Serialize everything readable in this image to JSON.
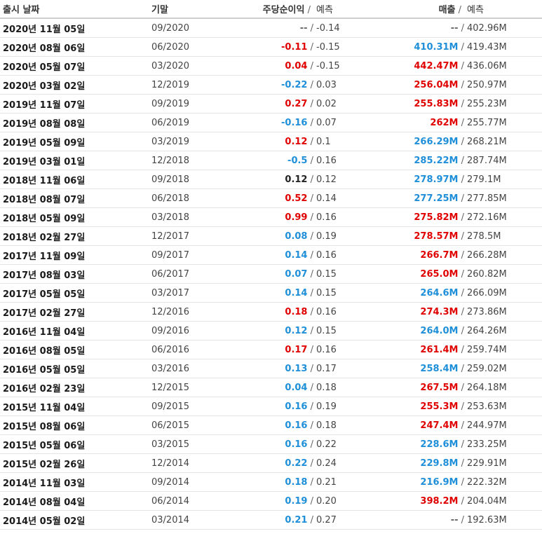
{
  "header": {
    "date": "출시 날짜",
    "period": "기말",
    "eps": "주당순이익",
    "sep": " / ",
    "forecast": "예측",
    "revenue": "매출",
    "sep2": " / ",
    "forecast2": "예측"
  },
  "colors": {
    "beat": "#1e8fd8",
    "miss": "#e00000",
    "neutral": "#222222"
  },
  "rows": [
    {
      "date": "2020년 11월 05일",
      "period": "09/2020",
      "eps": "--",
      "eps_status": "dim",
      "eps_sep": " /",
      "eps_forecast": "-0.14",
      "revenue": "--",
      "rev_status": "dim",
      "rev_sep": " /",
      "rev_forecast": "402.96M"
    },
    {
      "date": "2020년 08월 06일",
      "period": "06/2020",
      "eps": "-0.11",
      "eps_status": "neg",
      "eps_sep": " /",
      "eps_forecast": "-0.15",
      "revenue": "410.31M",
      "rev_status": "pos",
      "rev_sep": " /",
      "rev_forecast": "419.43M"
    },
    {
      "date": "2020년 05월 07일",
      "period": "03/2020",
      "eps": "0.04",
      "eps_status": "neg",
      "eps_sep": " /",
      "eps_forecast": "-0.15",
      "revenue": "442.47M",
      "rev_status": "neg",
      "rev_sep": " /",
      "rev_forecast": "436.06M"
    },
    {
      "date": "2020년 03월 02일",
      "period": "12/2019",
      "eps": "-0.22",
      "eps_status": "pos",
      "eps_sep": " /",
      "eps_forecast": "0.03",
      "revenue": "256.04M",
      "rev_status": "neg",
      "rev_sep": " /",
      "rev_forecast": "250.97M"
    },
    {
      "date": "2019년 11월 07일",
      "period": "09/2019",
      "eps": "0.27",
      "eps_status": "neg",
      "eps_sep": " /",
      "eps_forecast": "0.02",
      "revenue": "255.83M",
      "rev_status": "neg",
      "rev_sep": " /",
      "rev_forecast": "255.23M"
    },
    {
      "date": "2019년 08월 08일",
      "period": "06/2019",
      "eps": "-0.16",
      "eps_status": "pos",
      "eps_sep": " /",
      "eps_forecast": "0.07",
      "revenue": "262M",
      "rev_status": "neg",
      "rev_sep": " /",
      "rev_forecast": "255.77M"
    },
    {
      "date": "2019년 05월 09일",
      "period": "03/2019",
      "eps": "0.12",
      "eps_status": "neg",
      "eps_sep": " /",
      "eps_forecast": "0.1",
      "revenue": "266.29M",
      "rev_status": "pos",
      "rev_sep": " /",
      "rev_forecast": "268.21M"
    },
    {
      "date": "2019년 03월 01일",
      "period": "12/2018",
      "eps": "-0.5",
      "eps_status": "pos",
      "eps_sep": " /",
      "eps_forecast": "0.16",
      "revenue": "285.22M",
      "rev_status": "pos",
      "rev_sep": " /",
      "rev_forecast": "287.74M"
    },
    {
      "date": "2018년 11월 06일",
      "period": "09/2018",
      "eps": "0.12",
      "eps_status": "neu",
      "eps_sep": " /",
      "eps_forecast": "0.12",
      "revenue": "278.97M",
      "rev_status": "pos",
      "rev_sep": " /",
      "rev_forecast": "279.1M"
    },
    {
      "date": "2018년 08월 07일",
      "period": "06/2018",
      "eps": "0.52",
      "eps_status": "neg",
      "eps_sep": " /",
      "eps_forecast": "0.14",
      "revenue": "277.25M",
      "rev_status": "pos",
      "rev_sep": " /",
      "rev_forecast": "277.85M"
    },
    {
      "date": "2018년 05월 09일",
      "period": "03/2018",
      "eps": "0.99",
      "eps_status": "neg",
      "eps_sep": " /",
      "eps_forecast": "0.16",
      "revenue": "275.82M",
      "rev_status": "neg",
      "rev_sep": " /",
      "rev_forecast": "272.16M"
    },
    {
      "date": "2018년 02월 27일",
      "period": "12/2017",
      "eps": "0.08",
      "eps_status": "pos",
      "eps_sep": " /",
      "eps_forecast": "0.19",
      "revenue": "278.57M",
      "rev_status": "neg",
      "rev_sep": " /",
      "rev_forecast": "278.5M"
    },
    {
      "date": "2017년 11월 09일",
      "period": "09/2017",
      "eps": "0.14",
      "eps_status": "pos",
      "eps_sep": " /",
      "eps_forecast": "0.16",
      "revenue": "266.7M",
      "rev_status": "neg",
      "rev_sep": " /",
      "rev_forecast": "266.28M"
    },
    {
      "date": "2017년 08월 03일",
      "period": "06/2017",
      "eps": "0.07",
      "eps_status": "pos",
      "eps_sep": " /",
      "eps_forecast": "0.15",
      "revenue": "265.0M",
      "rev_status": "neg",
      "rev_sep": " /",
      "rev_forecast": "260.82M"
    },
    {
      "date": "2017년 05월 05일",
      "period": "03/2017",
      "eps": "0.14",
      "eps_status": "pos",
      "eps_sep": " /",
      "eps_forecast": "0.15",
      "revenue": "264.6M",
      "rev_status": "pos",
      "rev_sep": " /",
      "rev_forecast": "266.09M"
    },
    {
      "date": "2017년 02월 27일",
      "period": "12/2016",
      "eps": "0.18",
      "eps_status": "neg",
      "eps_sep": " /",
      "eps_forecast": "0.16",
      "revenue": "274.3M",
      "rev_status": "neg",
      "rev_sep": " /",
      "rev_forecast": "273.86M"
    },
    {
      "date": "2016년 11월 04일",
      "period": "09/2016",
      "eps": "0.12",
      "eps_status": "pos",
      "eps_sep": " /",
      "eps_forecast": "0.15",
      "revenue": "264.0M",
      "rev_status": "pos",
      "rev_sep": " /",
      "rev_forecast": "264.26M"
    },
    {
      "date": "2016년 08월 05일",
      "period": "06/2016",
      "eps": "0.17",
      "eps_status": "neg",
      "eps_sep": " /",
      "eps_forecast": "0.16",
      "revenue": "261.4M",
      "rev_status": "neg",
      "rev_sep": " /",
      "rev_forecast": "259.74M"
    },
    {
      "date": "2016년 05월 05일",
      "period": "03/2016",
      "eps": "0.13",
      "eps_status": "pos",
      "eps_sep": " /",
      "eps_forecast": "0.17",
      "revenue": "258.4M",
      "rev_status": "pos",
      "rev_sep": " /",
      "rev_forecast": "259.02M"
    },
    {
      "date": "2016년 02월 23일",
      "period": "12/2015",
      "eps": "0.04",
      "eps_status": "pos",
      "eps_sep": " /",
      "eps_forecast": "0.18",
      "revenue": "267.5M",
      "rev_status": "neg",
      "rev_sep": " /",
      "rev_forecast": "264.18M"
    },
    {
      "date": "2015년 11월 04일",
      "period": "09/2015",
      "eps": "0.16",
      "eps_status": "pos",
      "eps_sep": " /",
      "eps_forecast": "0.19",
      "revenue": "255.3M",
      "rev_status": "neg",
      "rev_sep": " /",
      "rev_forecast": "253.63M"
    },
    {
      "date": "2015년 08월 06일",
      "period": "06/2015",
      "eps": "0.16",
      "eps_status": "pos",
      "eps_sep": " /",
      "eps_forecast": "0.18",
      "revenue": "247.4M",
      "rev_status": "neg",
      "rev_sep": " /",
      "rev_forecast": "244.97M"
    },
    {
      "date": "2015년 05월 06일",
      "period": "03/2015",
      "eps": "0.16",
      "eps_status": "pos",
      "eps_sep": " /",
      "eps_forecast": "0.22",
      "revenue": "228.6M",
      "rev_status": "pos",
      "rev_sep": " /",
      "rev_forecast": "233.25M"
    },
    {
      "date": "2015년 02월 26일",
      "period": "12/2014",
      "eps": "0.22",
      "eps_status": "pos",
      "eps_sep": " /",
      "eps_forecast": "0.24",
      "revenue": "229.8M",
      "rev_status": "pos",
      "rev_sep": " /",
      "rev_forecast": "229.91M"
    },
    {
      "date": "2014년 11월 03일",
      "period": "09/2014",
      "eps": "0.18",
      "eps_status": "pos",
      "eps_sep": " /",
      "eps_forecast": "0.21",
      "revenue": "216.9M",
      "rev_status": "pos",
      "rev_sep": " /",
      "rev_forecast": "222.32M"
    },
    {
      "date": "2014년 08월 04일",
      "period": "06/2014",
      "eps": "0.19",
      "eps_status": "pos",
      "eps_sep": " /",
      "eps_forecast": "0.20",
      "revenue": "398.2M",
      "rev_status": "neg",
      "rev_sep": " /",
      "rev_forecast": "204.04M"
    },
    {
      "date": "2014년 05월 02일",
      "period": "03/2014",
      "eps": "0.21",
      "eps_status": "pos",
      "eps_sep": " /",
      "eps_forecast": "0.27",
      "revenue": "--",
      "rev_status": "dim",
      "rev_sep": " /",
      "rev_forecast": "192.63M"
    }
  ]
}
